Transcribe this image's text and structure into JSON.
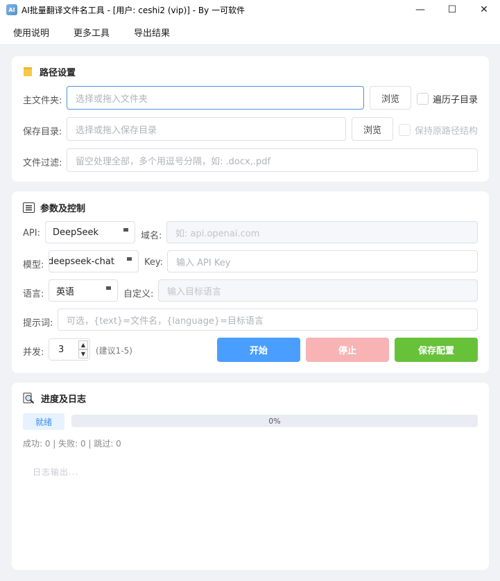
{
  "window": {
    "title": "AI批量翻译文件名工具 - [用户: ceshi2 (vip)] - By 一可软件",
    "icon_label": "AI",
    "controls": {
      "minimize": "—",
      "maximize": "☐",
      "close": "✕"
    }
  },
  "menu": [
    "使用说明",
    "更多工具",
    "导出结果"
  ],
  "path_panel": {
    "title": "路径设置",
    "main_folder": {
      "label": "主文件夹:",
      "placeholder": "选择或拖入文件夹",
      "browse": "浏览",
      "checkbox": "遍历子目录"
    },
    "save_dir": {
      "label": "保存目录:",
      "placeholder": "选择或拖入保存目录",
      "browse": "浏览",
      "checkbox": "保持原路径结构"
    },
    "filter": {
      "label": "文件过滤:",
      "placeholder": "留空处理全部，多个用逗号分隔，如: .docx,.pdf"
    }
  },
  "params_panel": {
    "title": "参数及控制",
    "api": {
      "label": "API:",
      "value": "DeepSeek"
    },
    "domain": {
      "label": "域名:",
      "placeholder": "如: api.openai.com"
    },
    "model": {
      "label": "模型:",
      "value": "deepseek-chat"
    },
    "key": {
      "label": "Key:",
      "placeholder": "输入 API Key"
    },
    "language": {
      "label": "语言:",
      "value": "英语"
    },
    "custom": {
      "label": "自定义:",
      "placeholder": "输入目标语言"
    },
    "prompt": {
      "label": "提示词:",
      "placeholder": "可选，{text}=文件名，{language}=目标语言"
    },
    "concurrency": {
      "label": "并发:",
      "value": "3",
      "hint": "(建议1-5)"
    },
    "buttons": {
      "start": "开始",
      "stop": "停止",
      "save": "保存配置"
    },
    "colors": {
      "start": "#4a9eff",
      "stop": "#f8b4b4",
      "save": "#67c23a"
    }
  },
  "progress_panel": {
    "title": "进度及日志",
    "status": "就绪",
    "progress": "0%",
    "stats": "成功: 0 | 失败: 0 | 跳过: 0",
    "log_placeholder": "日志输出..."
  }
}
